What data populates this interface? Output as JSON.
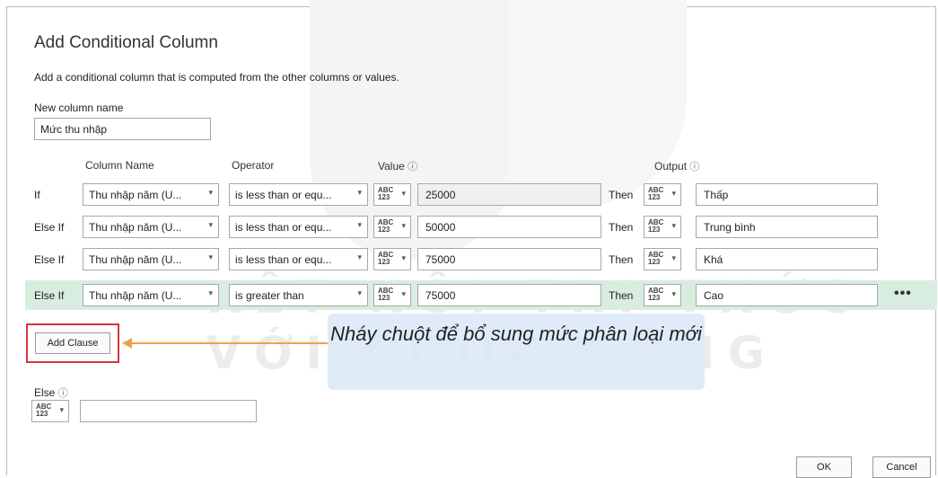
{
  "dialog": {
    "title": "Add Conditional Column",
    "description": "Add a conditional column that is computed from the other columns or values.",
    "new_column_label": "New column name",
    "new_column_value": "Mức thu nhập"
  },
  "headers": {
    "column_name": "Column Name",
    "operator": "Operator",
    "value": "Value",
    "output": "Output",
    "info_glyph": "ⓘ"
  },
  "type_icon": {
    "top": "ABC",
    "bottom": "123"
  },
  "caret_glyph": "▾",
  "rows": [
    {
      "label": "If",
      "column": "Thu nhập năm (U...",
      "operator": "is less than or equ...",
      "value": "25000",
      "then": "Then",
      "output": "Thấp"
    },
    {
      "label": "Else If",
      "column": "Thu nhập năm (U...",
      "operator": "is less than or equ...",
      "value": "50000",
      "then": "Then",
      "output": "Trung bình"
    },
    {
      "label": "Else If",
      "column": "Thu nhập năm (U...",
      "operator": "is less than or equ...",
      "value": "75000",
      "then": "Then",
      "output": "Khá"
    },
    {
      "label": "Else If",
      "column": "Thu nhập năm (U...",
      "operator": "is greater than",
      "value": "75000",
      "then": "Then",
      "output": "Cao"
    }
  ],
  "row_menu": "•••",
  "add_clause": "Add Clause",
  "callout": "Nháy chuột để bổ sung mức phân loại mới",
  "else_label": "Else",
  "else_value": "",
  "buttons": {
    "ok": "OK",
    "cancel": "Cancel"
  },
  "watermark": {
    "line1": "KẾT NỐI TRI THỨC",
    "line2": "VỚI CUỘC SỐNG"
  },
  "colors": {
    "accent_arrow": "#f0a24a",
    "highlight_frame": "#d8343a",
    "selected_row": "#d8ede0",
    "callout_bg": "#dbeaf6"
  }
}
